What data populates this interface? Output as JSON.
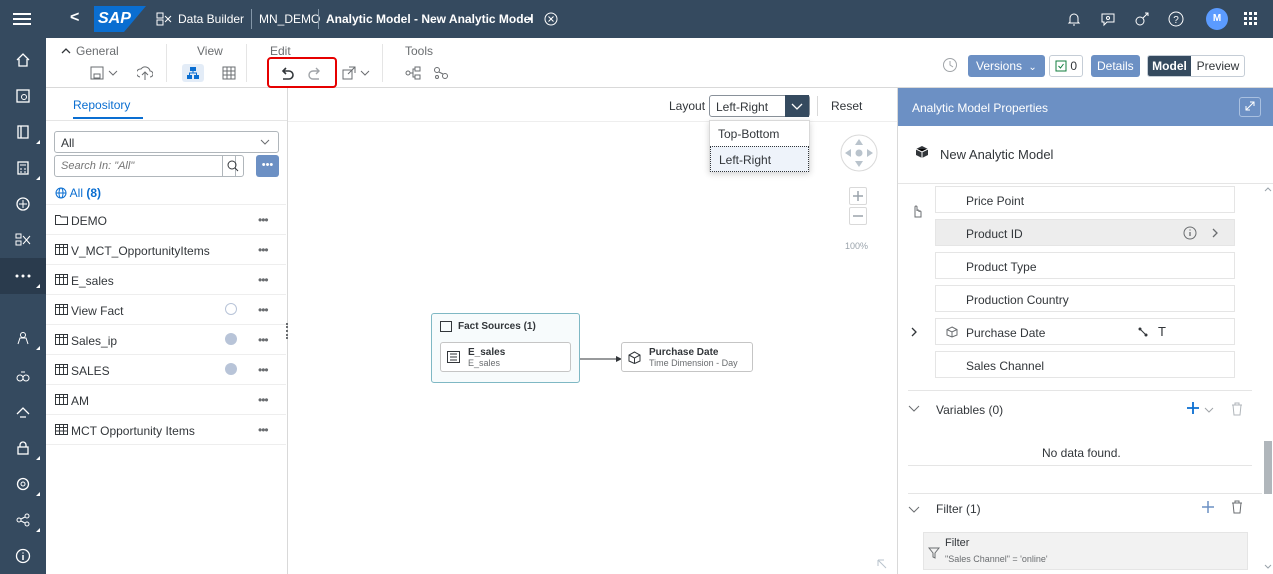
{
  "shell": {
    "back_label": "<",
    "logo_text": "SAP",
    "app_name": "Data Builder",
    "space": "MN_DEMO",
    "title": "Analytic Model - New Analytic Model",
    "modified_marker": "•",
    "avatar_initial": "M"
  },
  "toolbar": {
    "groups": {
      "general": "General",
      "view": "View",
      "edit": "Edit",
      "tools": "Tools"
    },
    "versions_label": "Versions",
    "validation_count": "0",
    "details_label": "Details",
    "model_label": "Model",
    "preview_label": "Preview"
  },
  "repository": {
    "tab": "Repository",
    "select_value": "All",
    "search_placeholder": "Search In: \"All\"",
    "all_label": "All",
    "all_count": "(8)",
    "more_label": "•••",
    "items": [
      {
        "name": "DEMO",
        "icon": "folder-icon",
        "shared": ""
      },
      {
        "name": "V_MCT_OpportunityItems",
        "icon": "view-icon",
        "shared": ""
      },
      {
        "name": "E_sales",
        "icon": "view-icon",
        "shared": ""
      },
      {
        "name": "View Fact",
        "icon": "view-icon",
        "shared": "outline"
      },
      {
        "name": "Sales_ip",
        "icon": "view-icon",
        "shared": "filled"
      },
      {
        "name": "SALES",
        "icon": "view-icon",
        "shared": "filled"
      },
      {
        "name": "AM",
        "icon": "view-icon",
        "shared": ""
      },
      {
        "name": "MCT Opportunity Items",
        "icon": "table-icon",
        "shared": ""
      }
    ]
  },
  "canvas": {
    "layout_label": "Layout",
    "layout_value": "Left-Right",
    "reset_label": "Reset",
    "layout_options": [
      "Top-Bottom",
      "Left-Right"
    ],
    "zoom": "100%",
    "fact_sources_title": "Fact Sources (1)",
    "fact_node": {
      "title": "E_sales",
      "subtitle": "E_sales"
    },
    "dim_node": {
      "title": "Purchase Date",
      "subtitle": "Time Dimension - Day"
    }
  },
  "properties": {
    "header": "Analytic Model Properties",
    "model_name": "New Analytic Model",
    "attributes": [
      "Price Point",
      "Product ID",
      "Product Type",
      "Production Country",
      "Purchase Date",
      "Sales Channel"
    ],
    "purchase_date_badge": "T",
    "variables_title": "Variables (0)",
    "no_data": "No data found.",
    "filter_title": "Filter (1)",
    "filter_item_title": "Filter",
    "filter_item_expr": "\"Sales Channel\" = 'online'"
  },
  "colors": {
    "shell": "#354a5f",
    "accent": "#6c90c4",
    "highlight": "#e60000",
    "link": "#0a6ed1"
  }
}
